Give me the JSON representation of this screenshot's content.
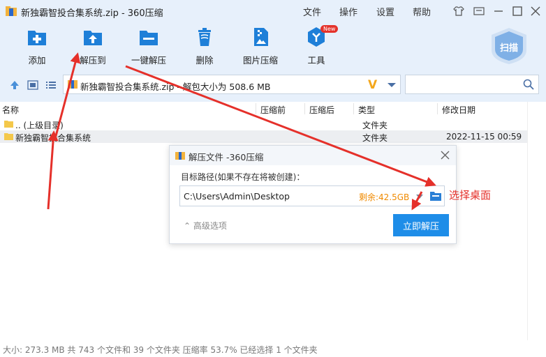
{
  "window": {
    "title": "新独霸智投合集系统.zip - 360压缩",
    "menus": [
      "文件",
      "操作",
      "设置",
      "帮助"
    ]
  },
  "toolbar": {
    "items": [
      {
        "label": "添加",
        "icon": "add-icon"
      },
      {
        "label": "解压到",
        "icon": "extract-to-icon"
      },
      {
        "label": "一键解压",
        "icon": "one-click-extract-icon"
      },
      {
        "label": "删除",
        "icon": "trash-icon"
      },
      {
        "label": "图片压缩",
        "icon": "image-compress-icon"
      },
      {
        "label": "工具",
        "icon": "tools-icon"
      }
    ],
    "new_badge": "New",
    "scan_label": "扫描"
  },
  "address": {
    "path": "新独霸智投合集系统.zip - 解包大小为 508.6 MB",
    "v_logo": "V"
  },
  "columns": [
    "名称",
    "压缩前",
    "压缩后",
    "类型",
    "修改日期"
  ],
  "rows": [
    {
      "name": ".. (上级目录)",
      "before": "",
      "after": "",
      "type": "文件夹",
      "date": ""
    },
    {
      "name": "新独霸智投合集系统",
      "before": "",
      "after": "",
      "type": "文件夹",
      "date": "2022-11-15 00:59"
    }
  ],
  "status": "大小: 273.3 MB 共 743 个文件和 39 个文件夹 压缩率 53.7% 已经选择 1 个文件夹",
  "dialog": {
    "title": "解压文件 -360压缩",
    "label": "目标路径(如果不存在将被创建)：",
    "path": "C:\\Users\\Admin\\Desktop",
    "free": "剩余:42.5GB",
    "advanced": "高级选项",
    "confirm": "立即解压"
  },
  "annotation": "选择桌面",
  "colors": {
    "accent": "#1e8de8",
    "annotation": "#e5302a",
    "free_space": "#f08a00"
  }
}
